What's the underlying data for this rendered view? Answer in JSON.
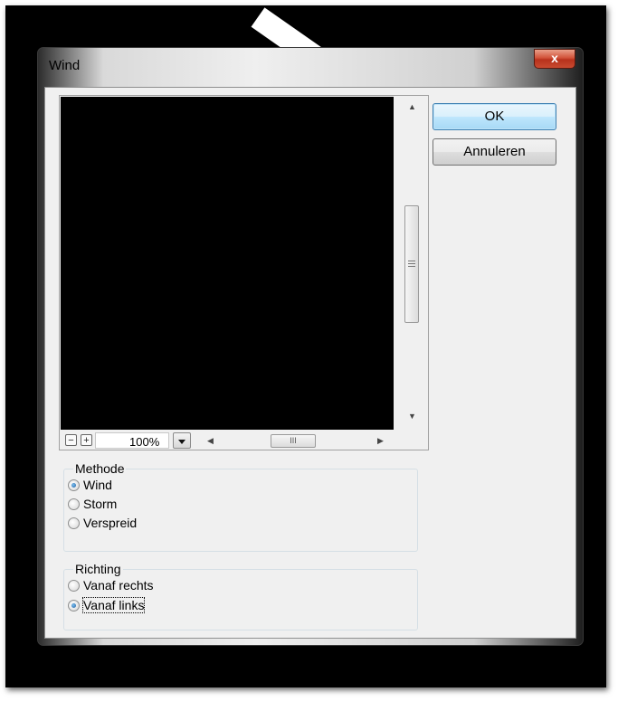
{
  "window": {
    "title": "Wind",
    "close_label": "x"
  },
  "preview": {
    "zoom_value": "100%",
    "zoom_out_label": "−",
    "zoom_in_label": "+",
    "hscroll_grip": "III"
  },
  "buttons": {
    "ok_label": "OK",
    "cancel_label": "Annuleren"
  },
  "methode": {
    "label": "Methode",
    "options": [
      {
        "label": "Wind",
        "checked": true
      },
      {
        "label": "Storm",
        "checked": false
      },
      {
        "label": "Verspreid",
        "checked": false
      }
    ]
  },
  "richting": {
    "label": "Richting",
    "options": [
      {
        "label": "Vanaf rechts",
        "checked": false
      },
      {
        "label": "Vanaf links",
        "checked": true
      }
    ]
  },
  "colors": {
    "background": "#000000",
    "dialog": "#f0f0f0",
    "close_button": "#c84a30",
    "default_button": "#bee6fd"
  }
}
